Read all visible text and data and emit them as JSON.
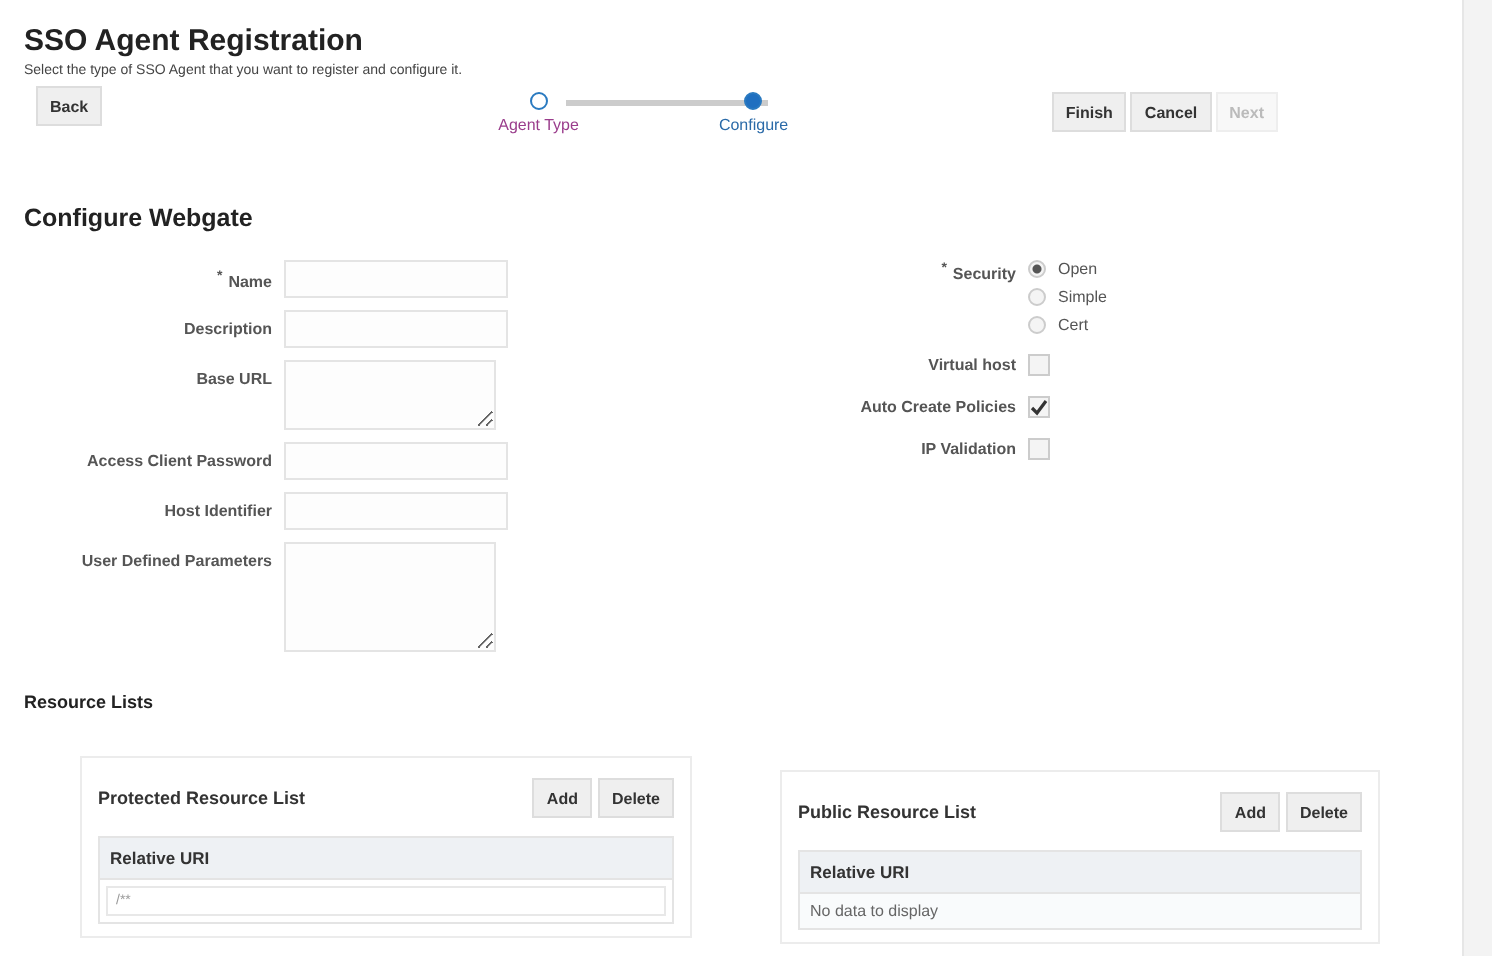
{
  "header": {
    "title": "SSO Agent Registration",
    "subtitle": "Select the type of SSO Agent that you want to register and configure it."
  },
  "back_button": "Back",
  "train": [
    {
      "label": "Agent Type",
      "selected": false
    },
    {
      "label": "Configure",
      "selected": true
    }
  ],
  "actions": [
    {
      "label": "Finish",
      "disabled": false
    },
    {
      "label": "Cancel",
      "disabled": false
    },
    {
      "label": "Next",
      "disabled": true
    }
  ],
  "section_title": "Configure Webgate",
  "fields": [
    {
      "required_mark": "*",
      "label": "Name",
      "kind": "input"
    },
    {
      "label": "Description",
      "kind": "input"
    },
    {
      "label": "Base URL",
      "kind": "textarea"
    },
    {
      "label": "Access Client Password",
      "kind": "input"
    },
    {
      "label": "Host Identifier",
      "kind": "input"
    },
    {
      "label": "User Defined Parameters",
      "kind": "textarea_tall"
    }
  ],
  "security": {
    "required_mark": "*",
    "label": "Security",
    "options": [
      {
        "label": "Open",
        "selected": true
      },
      {
        "label": "Simple",
        "selected": false
      },
      {
        "label": "Cert",
        "selected": false
      }
    ]
  },
  "checkboxes": [
    {
      "label": "Virtual host",
      "checked": false
    },
    {
      "label": "Auto Create Policies",
      "checked": true
    },
    {
      "label": "IP Validation",
      "checked": false
    }
  ],
  "resource_title": "Resource Lists",
  "panels": [
    {
      "title": "Protected Resource List",
      "buttons": [
        "Add",
        "Delete"
      ],
      "column": "Relative URI",
      "rows": [
        "/**"
      ]
    },
    {
      "title": "Public Resource List",
      "buttons": [
        "Add",
        "Delete"
      ],
      "column": "Relative URI",
      "empty_text": "No data to display"
    }
  ]
}
